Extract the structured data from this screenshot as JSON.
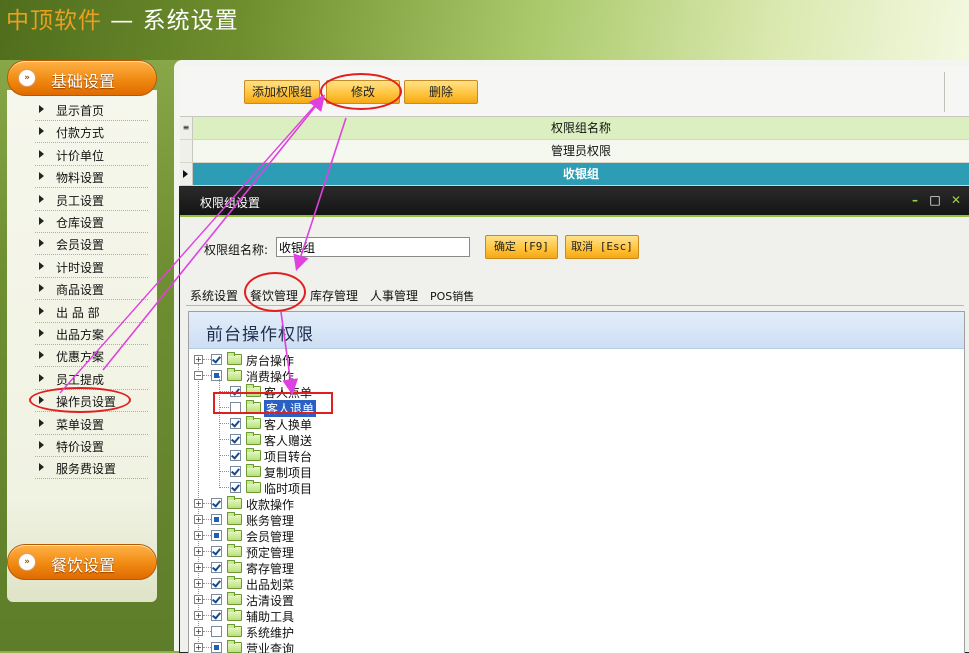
{
  "header": {
    "brand": "中顶软件",
    "title": " — 系统设置"
  },
  "sidebar": {
    "category_basic": "基础设置",
    "category_catering": "餐饮设置",
    "items": [
      {
        "label": "显示首页"
      },
      {
        "label": "付款方式"
      },
      {
        "label": "计价单位"
      },
      {
        "label": "物料设置"
      },
      {
        "label": "员工设置"
      },
      {
        "label": "仓库设置"
      },
      {
        "label": "会员设置"
      },
      {
        "label": "计时设置"
      },
      {
        "label": "商品设置"
      },
      {
        "label": "出 品 部"
      },
      {
        "label": "出品方案"
      },
      {
        "label": "优惠方案"
      },
      {
        "label": "员工提成"
      },
      {
        "label": "操作员设置"
      },
      {
        "label": "菜单设置"
      },
      {
        "label": "特价设置"
      },
      {
        "label": "服务费设置"
      }
    ]
  },
  "toolbar": {
    "add_label": "添加权限组",
    "edit_label": "修改",
    "delete_label": "删除"
  },
  "grid": {
    "column_header": "权限组名称",
    "rows": [
      "管理员权限",
      "收银组"
    ]
  },
  "dialog": {
    "title": "权限组设置",
    "group_name_label": "权限组名称:",
    "group_name_value": "收银组",
    "ok_label": "确定 [F9]",
    "cancel_label": "取消 [Esc]",
    "tabs": [
      "系统设置",
      "餐饮管理",
      "库存管理",
      "人事管理",
      "POS销售"
    ],
    "active_tab": "餐饮管理",
    "panel_title": "前台操作权限",
    "tree": [
      {
        "label": "房台操作",
        "state": "checked",
        "expanded": false
      },
      {
        "label": "消费操作",
        "state": "partial",
        "expanded": true,
        "children": [
          {
            "label": "客人点单",
            "state": "checked"
          },
          {
            "label": "客人退单",
            "state": "unchecked",
            "selected": true
          },
          {
            "label": "客人换单",
            "state": "checked"
          },
          {
            "label": "客人赠送",
            "state": "checked"
          },
          {
            "label": "项目转台",
            "state": "checked"
          },
          {
            "label": "复制项目",
            "state": "checked"
          },
          {
            "label": "临时项目",
            "state": "checked"
          }
        ]
      },
      {
        "label": "收款操作",
        "state": "checked",
        "expanded": false
      },
      {
        "label": "账务管理",
        "state": "partial",
        "expanded": false
      },
      {
        "label": "会员管理",
        "state": "partial",
        "expanded": false
      },
      {
        "label": "预定管理",
        "state": "checked",
        "expanded": false
      },
      {
        "label": "寄存管理",
        "state": "checked",
        "expanded": false
      },
      {
        "label": "出品划菜",
        "state": "checked",
        "expanded": false
      },
      {
        "label": "沽清设置",
        "state": "checked",
        "expanded": false
      },
      {
        "label": "辅助工具",
        "state": "checked",
        "expanded": false
      },
      {
        "label": "系统维护",
        "state": "unchecked",
        "expanded": false
      },
      {
        "label": "营业查询",
        "state": "partial",
        "expanded": false
      }
    ]
  },
  "colors": {
    "accent_orange": "#f08a12",
    "selected_row": "#2c9db5",
    "annotation": "#e02020",
    "arrow": "#e040e0"
  }
}
